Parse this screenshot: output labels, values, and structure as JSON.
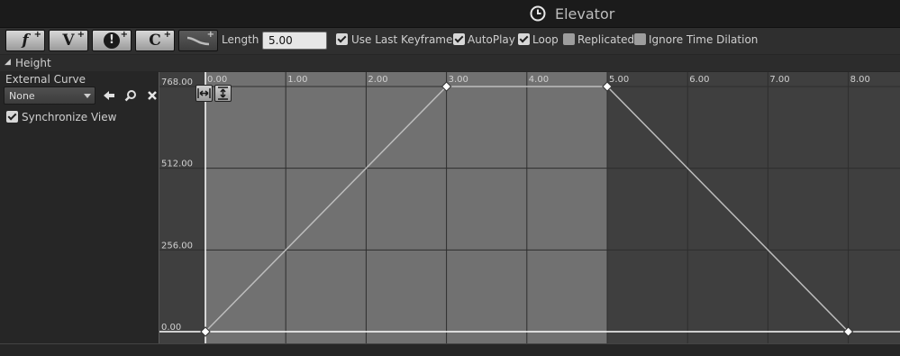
{
  "window": {
    "title": "Elevator",
    "title_icon": "clock-icon"
  },
  "toolbar": {
    "buttons": [
      {
        "glyph": "f",
        "name": "add-float-track"
      },
      {
        "glyph": "V",
        "name": "add-vector-track"
      },
      {
        "glyph": "!",
        "name": "add-event-track"
      },
      {
        "glyph": "C",
        "name": "add-color-track"
      },
      {
        "glyph": "~",
        "name": "add-curve-asset-track"
      }
    ],
    "length_label": "Length",
    "length_value": "5.00",
    "checks": [
      {
        "label": "Use Last Keyframe?",
        "checked": true
      },
      {
        "label": "AutoPlay",
        "checked": true
      },
      {
        "label": "Loop",
        "checked": true
      },
      {
        "label": "Replicated",
        "checked": false
      },
      {
        "label": "Ignore Time Dilation",
        "checked": false
      }
    ]
  },
  "track": {
    "name": "Height",
    "external_curve_label": "External Curve",
    "external_curve_value": "None",
    "synchronize_view_label": "Synchronize View",
    "synchronize_view_checked": true
  },
  "curve": {
    "x_ticks": [
      "0.00",
      "1.00",
      "2.00",
      "3.00",
      "4.00",
      "5.00",
      "6.00",
      "7.00",
      "8.00"
    ],
    "y_ticks": [
      "768.00",
      "512.00",
      "256.00",
      "0.00"
    ],
    "keys": [
      {
        "time": 0,
        "value": 0
      },
      {
        "time": 3,
        "value": 768
      },
      {
        "time": 5,
        "value": 768
      },
      {
        "time": 8,
        "value": 0
      }
    ],
    "active_range": [
      0,
      5
    ],
    "colors": {
      "active_bg": "#717171",
      "inactive_bg": "#3f3f3f",
      "curve": "#bdbdbd",
      "key": "#ffffff"
    }
  }
}
